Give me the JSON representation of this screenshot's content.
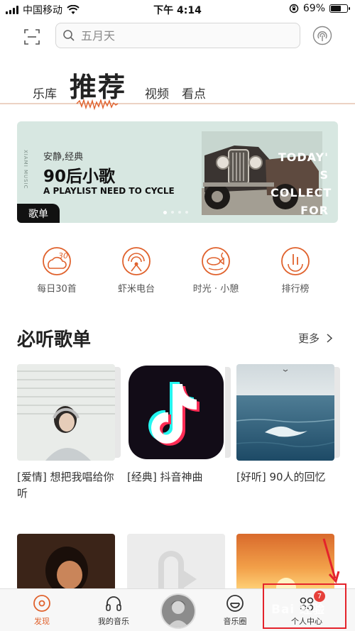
{
  "status_bar": {
    "carrier": "中国移动",
    "time": "下午 4:14",
    "battery_percent": "69%",
    "battery_level": 0.69
  },
  "search": {
    "placeholder": "五月天"
  },
  "tabs": [
    {
      "label": "乐库",
      "active": false
    },
    {
      "label": "推荐",
      "active": true
    },
    {
      "label": "视频",
      "active": false
    },
    {
      "label": "看点",
      "active": false
    }
  ],
  "banner": {
    "brand_vertical": "XIAMI MUSIC",
    "subtitle": "安静,经典",
    "title": "90后小歌",
    "tagline": "A PLAYLIST NEED TO CYCLE",
    "badge": "歌单",
    "photo_text": "TODAY' S COLLECT FOR YOU",
    "slide_count": 4,
    "active_slide": 1
  },
  "quick_entries": [
    {
      "label": "每日30首",
      "icon": "daily-30-icon"
    },
    {
      "label": "虾米电台",
      "icon": "radio-icon"
    },
    {
      "label": "时光 · 小憩",
      "icon": "time-rest-icon"
    },
    {
      "label": "排行榜",
      "icon": "chart-rank-icon"
    }
  ],
  "section": {
    "title": "必听歌单",
    "more_label": "更多"
  },
  "playlists": [
    {
      "caption": "[爱情] 想把我唱给你听",
      "cover": "headphones-photo"
    },
    {
      "caption": "[经典] 抖音神曲",
      "cover": "tiktok-logo"
    },
    {
      "caption": "[好听] 90人的回忆",
      "cover": "ocean-photo"
    }
  ],
  "bottom_nav": {
    "items": [
      {
        "label": "发现",
        "active": true,
        "icon": "discover-icon"
      },
      {
        "label": "我的音乐",
        "active": false,
        "icon": "headphones-icon"
      },
      {
        "label": "音乐圈",
        "active": false,
        "icon": "music-circle-icon"
      },
      {
        "label": "个人中心",
        "active": false,
        "icon": "person-center-icon"
      }
    ],
    "notification_count": "7"
  },
  "watermark": "Bai 经验",
  "colors": {
    "accent": "#e0622d",
    "annotation_red": "#e4232b",
    "banner_bg": "#d7e7e1"
  }
}
